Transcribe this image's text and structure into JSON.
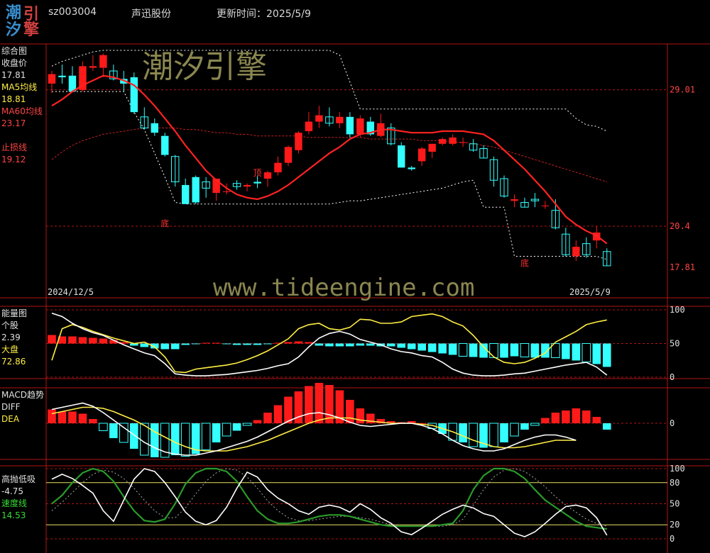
{
  "header": {
    "code": "sz003004",
    "name": "声迅股份",
    "update_label": "更新时间：2025/5/9"
  },
  "logo": {
    "chars": [
      "潮",
      "引",
      "汐",
      "擎"
    ]
  },
  "watermarks": {
    "cn": "潮汐引擎",
    "url": "www.tideengine.com"
  },
  "colors": {
    "grid": "#b01515",
    "up": "#ff1a1a",
    "down": "#33ffff",
    "white": "#ffffff",
    "yellow": "#ffee44",
    "green": "#2a9a2a",
    "ma60": "#c02020"
  },
  "panels": [
    {
      "key": "main",
      "labels": [
        {
          "text": "综合图",
          "color": "#e0e0e0"
        },
        {
          "text": "收盘价",
          "color": "#e0e0e0"
        },
        {
          "text": "17.81",
          "color": "#e0e0e0"
        },
        {
          "text": "MA5均线",
          "color": "#ffee44"
        },
        {
          "text": "18.81",
          "color": "#ffee44"
        },
        {
          "text": "MA60均线",
          "color": "#ff4444"
        },
        {
          "text": "23.17",
          "color": "#ff4444"
        },
        {
          "text": "",
          "color": "#000"
        },
        {
          "text": "止损线",
          "color": "#ff4444"
        },
        {
          "text": "19.12",
          "color": "#ff4444"
        }
      ]
    },
    {
      "key": "energy",
      "labels": [
        {
          "text": "能量图",
          "color": "#e0e0e0"
        },
        {
          "text": "个股",
          "color": "#e0e0e0"
        },
        {
          "text": "2.39",
          "color": "#e0e0e0"
        },
        {
          "text": "大盘",
          "color": "#ffee44"
        },
        {
          "text": "72.86",
          "color": "#ffee44"
        }
      ]
    },
    {
      "key": "macd",
      "labels": [
        {
          "text": "MACD趋势",
          "color": "#e0e0e0"
        },
        {
          "text": "DIFF",
          "color": "#e0e0e0"
        },
        {
          "text": "DEA",
          "color": "#ffee44"
        }
      ]
    },
    {
      "key": "hlsd",
      "labels": [
        {
          "text": "高抛低吸",
          "color": "#e0e0e0"
        },
        {
          "text": "-4.75",
          "color": "#e0e0e0"
        },
        {
          "text": "速度线",
          "color": "#33dd33"
        },
        {
          "text": "14.53",
          "color": "#33dd33"
        }
      ]
    }
  ],
  "main_axis": {
    "levels": [
      {
        "text": "29.01",
        "price": 29.01
      },
      {
        "text": "20.4",
        "price": 20.4
      },
      {
        "text": "17.81",
        "price": 17.81
      }
    ]
  },
  "energy_axis": [
    "100",
    "50",
    "0"
  ],
  "macd_axis": [
    "0"
  ],
  "hlsd_axis": [
    "100",
    "80",
    "50",
    "20",
    "0"
  ],
  "date_labels": {
    "start": "2024/12/5",
    "end": "2025/5/9"
  },
  "markers": [
    {
      "text": "底",
      "idx": 11,
      "price": 20.55
    },
    {
      "text": "顶",
      "idx": 20,
      "price": 23.75
    },
    {
      "text": "底",
      "idx": 46,
      "price": 18.05
    }
  ],
  "chart_data": {
    "type": "candlestick",
    "n_bars": 55,
    "price_range": [
      17.0,
      31.5
    ],
    "candles": [
      [
        29.4,
        30.2,
        28.8,
        30.0
      ],
      [
        29.9,
        30.6,
        29.4,
        29.8
      ],
      [
        29.9,
        30.5,
        28.9,
        28.9
      ],
      [
        29.0,
        30.8,
        28.9,
        30.5
      ],
      [
        30.4,
        31.2,
        30.2,
        30.5
      ],
      [
        30.4,
        31.3,
        29.8,
        31.2
      ],
      [
        30.2,
        30.6,
        29.6,
        29.7
      ],
      [
        29.7,
        30.2,
        28.9,
        29.4
      ],
      [
        29.8,
        30.1,
        27.5,
        27.6
      ],
      [
        27.3,
        27.9,
        26.5,
        26.6
      ],
      [
        26.9,
        27.2,
        26.1,
        26.3
      ],
      [
        26.1,
        26.3,
        24.8,
        24.9
      ],
      [
        24.8,
        24.9,
        22.9,
        23.2
      ],
      [
        23.0,
        23.4,
        21.8,
        21.8
      ],
      [
        23.5,
        23.6,
        21.8,
        21.9
      ],
      [
        23.2,
        23.5,
        22.2,
        22.8
      ],
      [
        22.5,
        23.4,
        22.0,
        23.4
      ],
      [
        22.6,
        23.1,
        22.4,
        22.6
      ],
      [
        23.1,
        23.3,
        22.7,
        22.9
      ],
      [
        22.9,
        23.1,
        22.6,
        23.0
      ],
      [
        23.2,
        23.6,
        22.8,
        23.1
      ],
      [
        23.4,
        23.9,
        22.9,
        23.8
      ],
      [
        23.8,
        24.8,
        23.6,
        24.4
      ],
      [
        24.4,
        25.5,
        24.2,
        25.4
      ],
      [
        25.2,
        26.4,
        25.0,
        26.3
      ],
      [
        26.4,
        27.6,
        26.2,
        27.0
      ],
      [
        27.0,
        28.0,
        26.6,
        27.4
      ],
      [
        27.3,
        27.9,
        26.7,
        26.9
      ],
      [
        26.9,
        27.6,
        26.6,
        27.3
      ],
      [
        27.3,
        27.6,
        26.0,
        26.2
      ],
      [
        26.2,
        27.4,
        26.0,
        27.2
      ],
      [
        27.0,
        27.3,
        26.1,
        26.2
      ],
      [
        26.1,
        27.5,
        26.0,
        26.9
      ],
      [
        26.6,
        26.9,
        25.5,
        25.6
      ],
      [
        25.5,
        25.7,
        24.1,
        24.1
      ],
      [
        24.1,
        24.2,
        23.9,
        24.0
      ],
      [
        24.5,
        25.4,
        24.2,
        25.3
      ],
      [
        25.1,
        25.6,
        24.7,
        25.6
      ],
      [
        25.6,
        26.0,
        25.5,
        25.9
      ],
      [
        25.6,
        26.2,
        25.5,
        26.0
      ],
      [
        25.7,
        26.0,
        25.4,
        25.7
      ],
      [
        25.6,
        25.9,
        25.1,
        25.2
      ],
      [
        25.3,
        25.5,
        24.7,
        24.7
      ],
      [
        24.6,
        24.8,
        22.9,
        23.3
      ],
      [
        23.4,
        23.6,
        22.2,
        22.3
      ],
      [
        22.0,
        22.4,
        21.6,
        22.1
      ],
      [
        21.9,
        22.2,
        21.6,
        21.6
      ],
      [
        22.1,
        22.5,
        21.6,
        22.0
      ],
      [
        21.7,
        22.0,
        21.5,
        21.7
      ],
      [
        21.4,
        22.1,
        20.2,
        20.3
      ],
      [
        19.9,
        20.3,
        18.5,
        18.6
      ],
      [
        18.5,
        19.5,
        18.2,
        19.1
      ],
      [
        19.3,
        19.7,
        18.4,
        18.6
      ],
      [
        19.5,
        20.4,
        19.0,
        20.0
      ],
      [
        18.8,
        19.0,
        17.9,
        17.9
      ]
    ],
    "ma_red": [
      28.0,
      28.4,
      28.9,
      29.3,
      29.6,
      29.9,
      29.8,
      29.6,
      29.3,
      28.7,
      28.0,
      27.2,
      26.4,
      25.5,
      24.7,
      23.9,
      23.3,
      22.8,
      22.4,
      22.2,
      22.1,
      22.3,
      22.6,
      23.0,
      23.5,
      24.0,
      24.5,
      25.0,
      25.4,
      25.9,
      26.2,
      26.3,
      26.5,
      26.5,
      26.4,
      26.3,
      26.3,
      26.3,
      26.4,
      26.4,
      26.4,
      26.3,
      26.2,
      25.8,
      25.2,
      24.6,
      24.0,
      23.3,
      22.6,
      21.8,
      21.0,
      20.5,
      20.1,
      19.8,
      19.3
    ],
    "ma60": [
      24.6,
      25.1,
      25.5,
      25.8,
      26.0,
      26.2,
      26.3,
      26.4,
      26.5,
      26.6,
      26.6,
      26.6,
      26.6,
      26.5,
      26.5,
      26.4,
      26.3,
      26.3,
      26.2,
      26.2,
      26.1,
      26.1,
      26.1,
      26.1,
      26.1,
      26.0,
      26.0,
      26.0,
      26.0,
      26.0,
      26.0,
      25.9,
      25.9,
      25.9,
      25.9,
      25.9,
      25.8,
      25.8,
      25.8,
      25.7,
      25.7,
      25.6,
      25.5,
      25.4,
      25.2,
      25.0,
      24.8,
      24.6,
      24.4,
      24.2,
      24.0,
      23.8,
      23.6,
      23.4,
      23.2
    ],
    "upper_band": [
      30.5,
      30.8,
      31.0,
      31.2,
      31.4,
      31.5,
      31.5,
      31.5,
      31.5,
      31.5,
      31.5,
      31.5,
      31.5,
      31.5,
      31.5,
      31.5,
      31.5,
      31.5,
      31.5,
      31.5,
      31.5,
      31.5,
      31.5,
      31.5,
      31.5,
      31.5,
      31.5,
      31.5,
      31.2,
      29.5,
      27.8,
      27.8,
      27.8,
      27.8,
      27.8,
      27.8,
      27.8,
      27.8,
      27.8,
      27.8,
      27.8,
      27.8,
      27.8,
      27.8,
      27.8,
      27.8,
      27.8,
      27.8,
      27.8,
      27.8,
      27.8,
      27.2,
      26.8,
      26.7,
      26.4
    ],
    "lower_band": [
      28.9,
      28.9,
      28.9,
      28.9,
      28.9,
      28.9,
      28.9,
      28.9,
      27.6,
      26.5,
      25.0,
      23.5,
      21.9,
      21.8,
      21.8,
      21.8,
      21.8,
      21.8,
      21.8,
      21.8,
      21.8,
      21.8,
      21.8,
      21.8,
      21.8,
      21.8,
      21.8,
      21.8,
      21.9,
      22.0,
      22.0,
      22.1,
      22.2,
      22.3,
      22.4,
      22.5,
      22.6,
      22.7,
      22.8,
      23.0,
      23.2,
      23.3,
      21.6,
      21.6,
      21.6,
      18.5,
      18.5,
      18.5,
      18.5,
      18.5,
      18.5,
      18.5,
      18.5,
      18.5,
      18.3
    ],
    "energy_stock": [
      95,
      90,
      80,
      72,
      66,
      62,
      55,
      48,
      42,
      36,
      32,
      20,
      5,
      3,
      2,
      2,
      3,
      4,
      6,
      8,
      10,
      13,
      17,
      20,
      30,
      45,
      58,
      65,
      68,
      64,
      56,
      52,
      48,
      42,
      38,
      36,
      32,
      30,
      22,
      12,
      6,
      3,
      2,
      2,
      3,
      5,
      6,
      9,
      12,
      15,
      18,
      20,
      22,
      15,
      3
    ],
    "energy_market": [
      25,
      72,
      78,
      74,
      68,
      63,
      58,
      54,
      50,
      52,
      45,
      30,
      8,
      7,
      12,
      14,
      16,
      18,
      21,
      26,
      32,
      39,
      48,
      57,
      72,
      78,
      80,
      72,
      70,
      74,
      86,
      85,
      80,
      80,
      82,
      90,
      92,
      94,
      90,
      82,
      76,
      62,
      45,
      30,
      22,
      20,
      22,
      28,
      36,
      52,
      60,
      68,
      78,
      82,
      85
    ],
    "energy_bars": [
      12,
      10,
      10,
      9,
      8,
      7,
      5,
      2,
      -3,
      -5,
      -7,
      -8,
      -8,
      -2,
      -1,
      1,
      1,
      -1,
      -2,
      -2,
      -2,
      -1,
      1,
      2,
      3,
      2,
      -3,
      -4,
      -4,
      -4,
      -3,
      -3,
      -4,
      -4,
      -6,
      -8,
      -10,
      -12,
      -14,
      -16,
      -18,
      -19,
      -20,
      -20,
      -20,
      -18,
      -19,
      -20,
      -20,
      -20,
      -22,
      -24,
      -26,
      -29,
      -33
    ],
    "macd_diff": [
      1.3,
      1.5,
      1.7,
      1.9,
      1.6,
      1.0,
      0.3,
      -0.4,
      -1.1,
      -1.8,
      -2.3,
      -2.7,
      -2.9,
      -3.0,
      -3.0,
      -2.8,
      -2.6,
      -2.3,
      -2.0,
      -1.7,
      -1.3,
      -0.8,
      -0.3,
      0.2,
      0.6,
      0.9,
      1.0,
      0.8,
      0.5,
      0.1,
      -0.2,
      -0.3,
      -0.2,
      -0.1,
      0.0,
      0.0,
      -0.2,
      -0.5,
      -1.0,
      -1.6,
      -2.1,
      -2.4,
      -2.6,
      -2.6,
      -2.4,
      -2.0,
      -1.6,
      -1.3,
      -1.1,
      -1.1,
      -1.3,
      -1.6
    ],
    "macd_dea": [
      0.9,
      1.1,
      1.3,
      1.5,
      1.5,
      1.4,
      1.1,
      0.7,
      0.3,
      -0.2,
      -0.8,
      -1.3,
      -1.8,
      -2.2,
      -2.5,
      -2.6,
      -2.6,
      -2.6,
      -2.4,
      -2.2,
      -1.9,
      -1.6,
      -1.2,
      -0.8,
      -0.4,
      0.0,
      0.3,
      0.5,
      0.5,
      0.5,
      0.3,
      0.2,
      0.1,
      0.0,
      0.0,
      0.0,
      -0.1,
      -0.2,
      -0.5,
      -0.8,
      -1.2,
      -1.6,
      -1.9,
      -2.2,
      -2.3,
      -2.3,
      -2.2,
      -2.0,
      -1.8,
      -1.6,
      -1.6,
      -1.6
    ],
    "macd_hist": [
      1.3,
      1.1,
      1.1,
      0.9,
      0.4,
      -0.7,
      -1.4,
      -1.8,
      -2.4,
      -3.0,
      -3.2,
      -3.2,
      -3.0,
      -3.1,
      -2.9,
      -2.5,
      -1.8,
      -1.2,
      -0.7,
      -0.2,
      0.3,
      1.0,
      1.7,
      2.5,
      3.0,
      3.5,
      3.8,
      3.6,
      3.1,
      2.2,
      1.4,
      0.9,
      0.4,
      0.2,
      0.1,
      0.2,
      0.0,
      -0.5,
      -1.0,
      -1.6,
      -1.8,
      -2.2,
      -2.3,
      -2.2,
      -1.8,
      -1.2,
      -0.6,
      -0.2,
      0.5,
      1.0,
      1.2,
      1.4,
      1.2,
      0.6,
      -0.6
    ],
    "hlsd_white": [
      85,
      92,
      86,
      76,
      65,
      40,
      25,
      55,
      85,
      100,
      96,
      80,
      60,
      38,
      25,
      20,
      26,
      45,
      72,
      95,
      88,
      70,
      58,
      50,
      40,
      35,
      45,
      48,
      45,
      38,
      50,
      42,
      30,
      22,
      10,
      6,
      15,
      25,
      35,
      42,
      48,
      44,
      36,
      32,
      20,
      8,
      3,
      10,
      22,
      35,
      46,
      48,
      44,
      30,
      5
    ],
    "hlsd_green": [
      50,
      62,
      80,
      94,
      100,
      96,
      82,
      60,
      40,
      26,
      24,
      28,
      50,
      78,
      94,
      100,
      100,
      96,
      82,
      60,
      40,
      28,
      22,
      22,
      24,
      28,
      32,
      34,
      34,
      32,
      28,
      24,
      20,
      18,
      18,
      18,
      18,
      18,
      20,
      22,
      40,
      70,
      90,
      100,
      100,
      96,
      86,
      70,
      55,
      45,
      35,
      25,
      18,
      16,
      14
    ],
    "hlsd_dash": [
      40,
      52,
      66,
      80,
      92,
      98,
      95,
      86,
      72,
      55,
      40,
      30,
      30,
      44,
      64,
      82,
      94,
      100,
      98,
      88,
      72,
      54,
      40,
      30,
      26,
      26,
      28,
      30,
      32,
      32,
      30,
      28,
      24,
      20,
      18,
      18,
      18,
      18,
      18,
      20,
      28,
      48,
      70,
      88,
      98,
      100,
      96,
      86,
      74,
      60,
      48,
      38,
      28,
      22,
      18
    ]
  }
}
